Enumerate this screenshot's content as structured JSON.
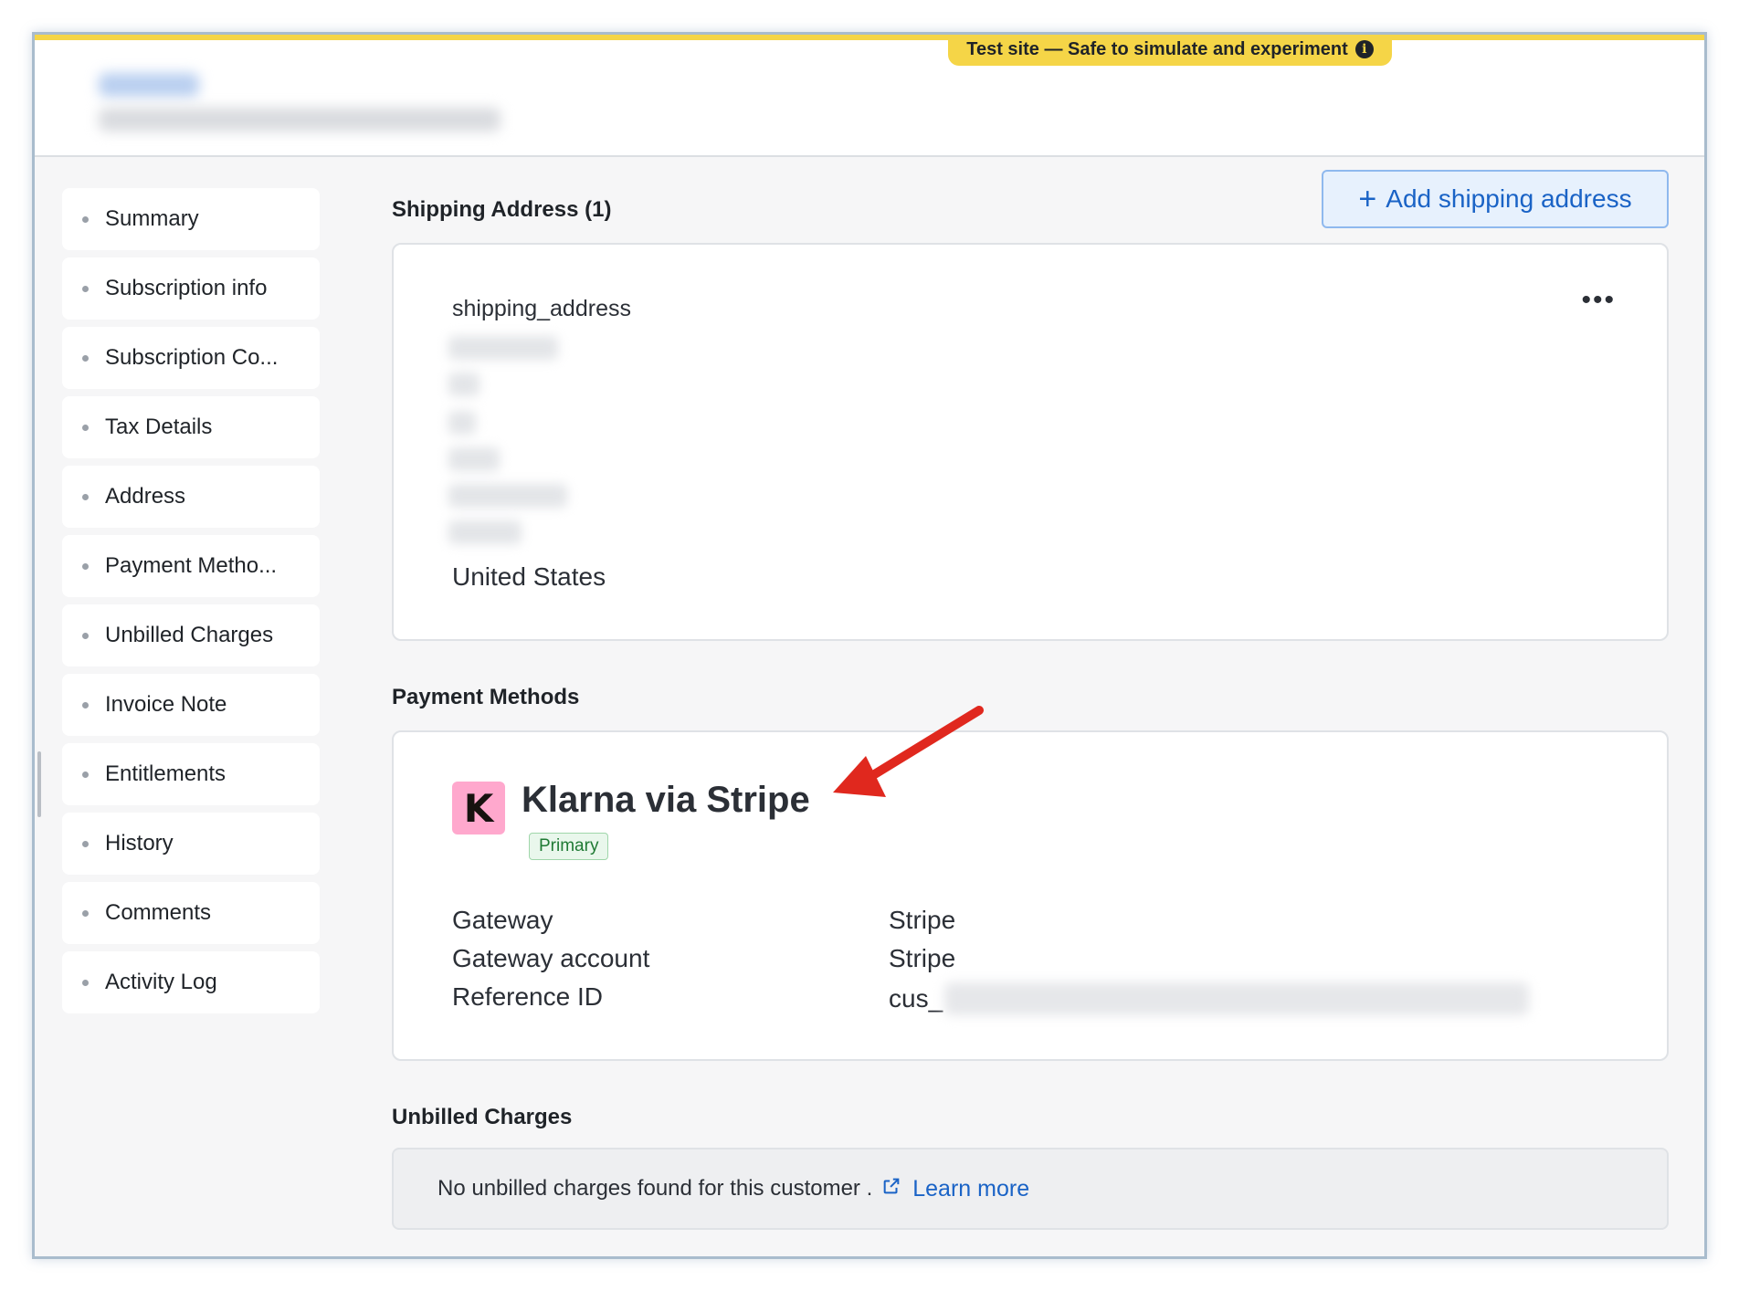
{
  "banner": {
    "text": "Test site — Safe to simulate and experiment",
    "icon": "info-icon"
  },
  "sidebar": {
    "items": [
      {
        "label": "Summary"
      },
      {
        "label": "Subscription info"
      },
      {
        "label": "Subscription Co..."
      },
      {
        "label": "Tax Details"
      },
      {
        "label": "Address"
      },
      {
        "label": "Payment Metho..."
      },
      {
        "label": "Unbilled Charges"
      },
      {
        "label": "Invoice Note"
      },
      {
        "label": "Entitlements"
      },
      {
        "label": "History"
      },
      {
        "label": "Comments"
      },
      {
        "label": "Activity Log"
      }
    ]
  },
  "shipping": {
    "title": "Shipping Address (1)",
    "add_button_label": "Add shipping address",
    "address_label": "shipping_address",
    "country": "United States",
    "more_icon": "more-horizontal-icon"
  },
  "payment_methods": {
    "title": "Payment Methods",
    "logo_letter": "K",
    "name": "Klarna via Stripe",
    "badge": "Primary",
    "rows": [
      {
        "key": "Gateway",
        "value": "Stripe"
      },
      {
        "key": "Gateway account",
        "value": "Stripe"
      },
      {
        "key": "Reference ID",
        "value": "cus_"
      }
    ]
  },
  "unbilled": {
    "title": "Unbilled Charges",
    "message": "No unbilled charges found for this customer .",
    "link": "Learn more",
    "link_icon": "external-link-icon"
  },
  "colors": {
    "banner": "#f5d547",
    "accent_blue": "#1a63c6",
    "klarna_pink": "#ffa8cd",
    "badge_green": "#1f7a34",
    "annotation_arrow": "#e0281e"
  }
}
